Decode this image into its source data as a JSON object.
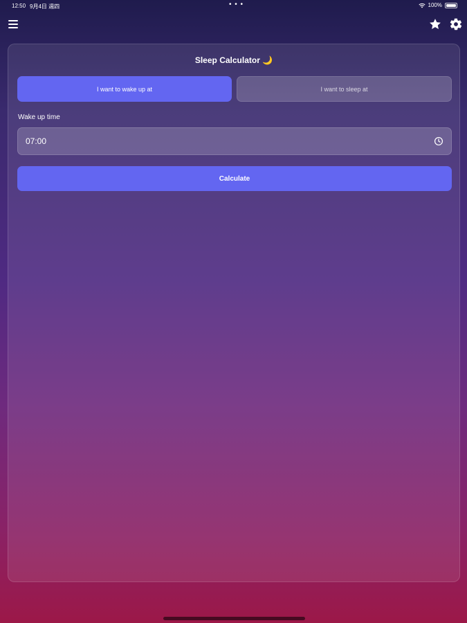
{
  "status_bar": {
    "time": "12:50",
    "date": "9月4日 週四",
    "dots": "• • •",
    "battery_text": "100%",
    "battery_level": 1.0
  },
  "top_bar": {
    "icons": [
      "menu-icon",
      "star-icon",
      "gear-icon"
    ]
  },
  "calculator": {
    "title": "Sleep Calculator 🌙",
    "mode_options": [
      "I want to wake up at",
      "I want to sleep at"
    ],
    "selected_mode": "I want to wake up at",
    "field_label": "Wake up time",
    "time_value": "07:00",
    "calculate_label": "Calculate"
  },
  "colors": {
    "accent": "#6366f1",
    "background_top": "#1f1b4d",
    "background_bottom": "#9c1848"
  }
}
